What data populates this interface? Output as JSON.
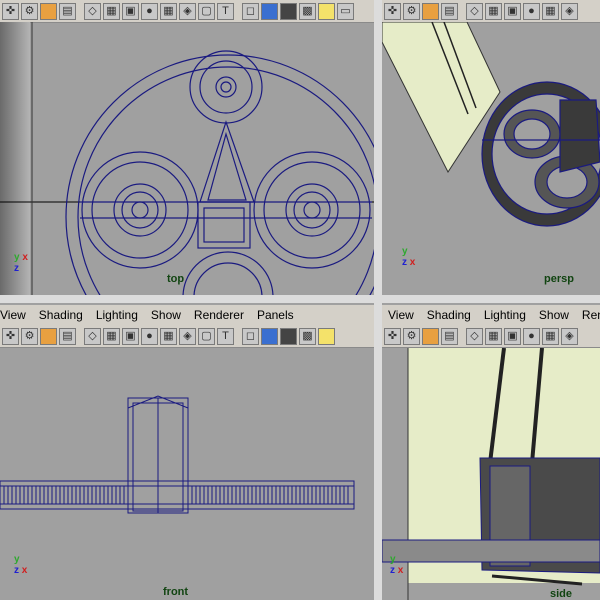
{
  "menu": {
    "view": "View",
    "shading": "Shading",
    "lighting": "Lighting",
    "show": "Show",
    "renderer": "Renderer",
    "panels": "Panels",
    "renderer_cut": "Rende"
  },
  "viewports": {
    "top": {
      "label": "top"
    },
    "persp": {
      "label": "persp"
    },
    "front": {
      "label": "front"
    },
    "side": {
      "label": "side"
    }
  },
  "axes": {
    "y": "y",
    "x": "x",
    "z": "z"
  },
  "colors": {
    "viewport_bg": "#a0a0a0",
    "wireframe": "#1a1a80",
    "toolbar_bg": "#d4d0c8",
    "plane": "#e6ecc8"
  },
  "toolbar_icons": [
    "camera-icon",
    "camera-attr-icon",
    "bookmark-icon",
    "image-plane-icon",
    "wireframe-icon",
    "smooth-shade-icon",
    "textured-icon",
    "lights-icon",
    "grid-icon",
    "xray-icon",
    "resolution-icon",
    "isolate-icon",
    "cube-icon",
    "shaded-cube-icon",
    "light-bulb-icon"
  ]
}
